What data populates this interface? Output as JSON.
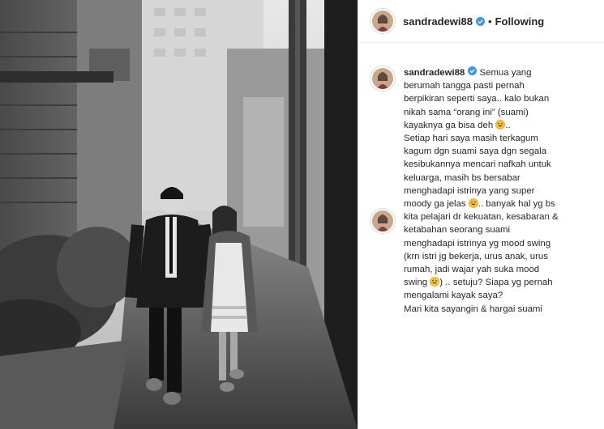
{
  "post": {
    "username": "sandradewi88",
    "separator": "•",
    "follow_status": "Following",
    "caption_lines": [
      "Semua yang",
      "berumah tangga pasti pernah",
      "berpikiran seperti saya.. kalo bukan",
      "nikah sama “orang ini” (suami)",
      "kayaknya ga bisa deh",
      "Setiap hari saya masih terkagum",
      "kagum dgn suami saya dgn segala",
      "kesibukannya mencari nafkah untuk",
      "keluarga, masih bs bersabar",
      "menghadapi istrinya yang super",
      "moody ga jelas",
      "kita pelajari dr kekuatan, kesabaran &",
      "ketabahan seorang suami",
      "menghadapi istrinya yg mood swing",
      "(krn istri jg bekerja, urus anak, urus",
      "rumah, jadi wajar yah suka mood",
      "swing",
      "mengalami kayak saya?",
      "Mari kita sayangin & hargai suami"
    ],
    "caption_fragments": {
      "after_emoji_1": "..",
      "after_emoji_2": ".. banyak hal yg bs",
      "after_emoji_3": ") .. setuju? Siapa yg pernah"
    },
    "emoji": "rofl-emoji",
    "colors": {
      "text": "#262626",
      "verified": "#3897f0",
      "border": "#efefef",
      "emoji_face": "#f5c33b"
    }
  }
}
